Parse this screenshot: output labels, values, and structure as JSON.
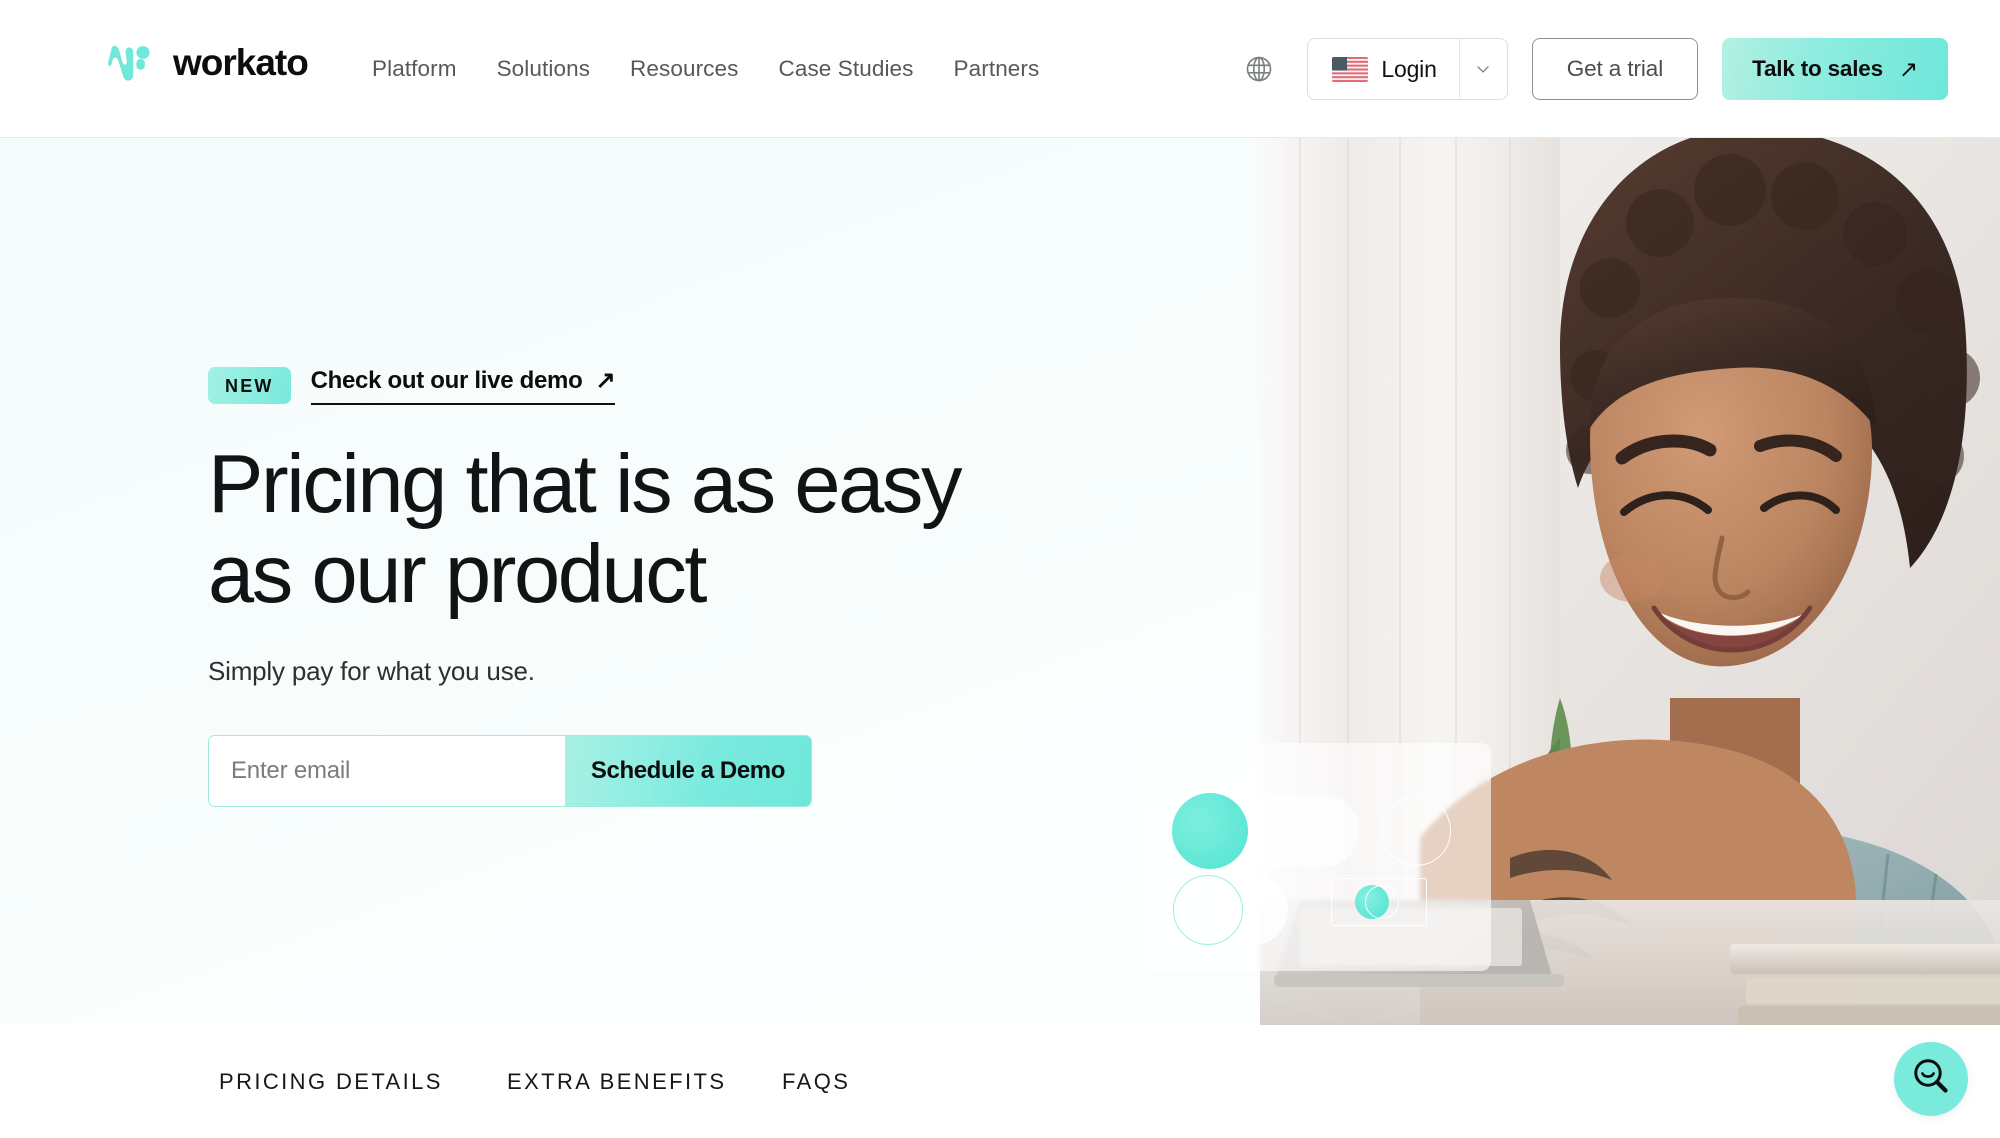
{
  "header": {
    "logo": {
      "text": "workato",
      "icon": "workato-logo-icon",
      "color": "#6fe8da"
    },
    "nav": [
      {
        "label": "Platform"
      },
      {
        "label": "Solutions"
      },
      {
        "label": "Resources"
      },
      {
        "label": "Case Studies"
      },
      {
        "label": "Partners"
      }
    ],
    "globe_icon": "globe-icon",
    "login": {
      "label": "Login",
      "flag": "us-flag-icon",
      "caret": "chevron-down-icon"
    },
    "trial_button": {
      "label": "Get a trial"
    },
    "sales_button": {
      "label": "Talk to sales",
      "icon": "arrow-up-right-icon",
      "glyph": "↗"
    }
  },
  "hero": {
    "badge": "NEW",
    "demo_link": {
      "label": "Check out our live demo",
      "icon": "arrow-up-right-icon",
      "glyph": "↗"
    },
    "title_line1": "Pricing that is as easy",
    "title_line2": "as our product",
    "subtitle": "Simply pay for what you use.",
    "form": {
      "email_placeholder": "Enter email",
      "email_value": "",
      "submit_label": "Schedule a Demo"
    },
    "photo_alt": "smiling-woman-at-laptop-photo",
    "toggle_graphic": "toggle-switches-illustration"
  },
  "section_nav": {
    "items": [
      {
        "label": "PRICING DETAILS"
      },
      {
        "label": "EXTRA BENEFITS"
      },
      {
        "label": "FAQS"
      }
    ]
  },
  "search_fab": {
    "icon": "search-smile-icon"
  },
  "colors": {
    "accent": "#6ee7da",
    "accent_light": "#a8f1e4",
    "hero_bg": "#f4fcfb",
    "text_dark": "#111314",
    "text_muted": "#55595a"
  }
}
